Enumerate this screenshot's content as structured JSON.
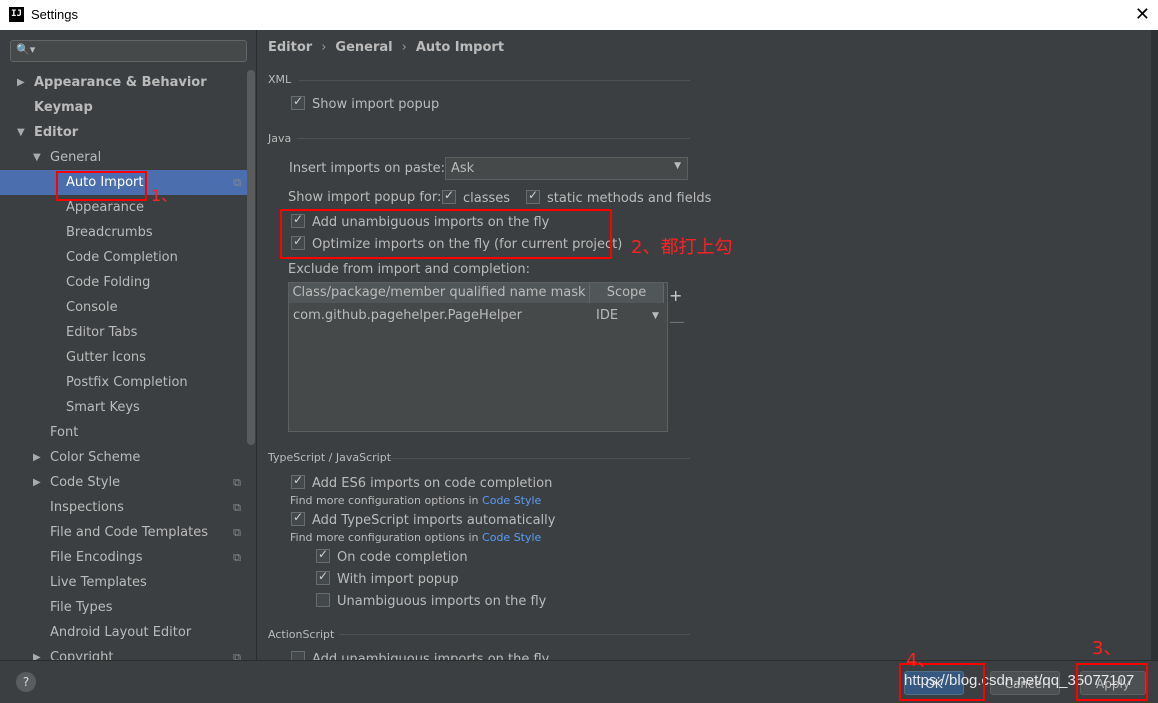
{
  "window": {
    "title": "Settings",
    "app_icon": "IJ",
    "close": "✕"
  },
  "sidebar": {
    "search_icon": "🔍▾",
    "items": [
      {
        "label": "Appearance & Behavior",
        "level": 0,
        "arrow": "▶",
        "bold": true
      },
      {
        "label": "Keymap",
        "level": 0,
        "arrow": "",
        "bold": true
      },
      {
        "label": "Editor",
        "level": 0,
        "arrow": "▼",
        "bold": true
      },
      {
        "label": "General",
        "level": 1,
        "arrow": "▼"
      },
      {
        "label": "Auto Import",
        "level": 2,
        "selected": true,
        "copy": true
      },
      {
        "label": "Appearance",
        "level": 2
      },
      {
        "label": "Breadcrumbs",
        "level": 2
      },
      {
        "label": "Code Completion",
        "level": 2
      },
      {
        "label": "Code Folding",
        "level": 2
      },
      {
        "label": "Console",
        "level": 2
      },
      {
        "label": "Editor Tabs",
        "level": 2
      },
      {
        "label": "Gutter Icons",
        "level": 2
      },
      {
        "label": "Postfix Completion",
        "level": 2
      },
      {
        "label": "Smart Keys",
        "level": 2
      },
      {
        "label": "Font",
        "level": 1
      },
      {
        "label": "Color Scheme",
        "level": 1,
        "arrow": "▶"
      },
      {
        "label": "Code Style",
        "level": 1,
        "arrow": "▶",
        "copy": true
      },
      {
        "label": "Inspections",
        "level": 1,
        "copy": true
      },
      {
        "label": "File and Code Templates",
        "level": 1,
        "copy": true
      },
      {
        "label": "File Encodings",
        "level": 1,
        "copy": true
      },
      {
        "label": "Live Templates",
        "level": 1
      },
      {
        "label": "File Types",
        "level": 1
      },
      {
        "label": "Android Layout Editor",
        "level": 1
      },
      {
        "label": "Copyright",
        "level": 1,
        "arrow": "▶",
        "copy": true
      }
    ]
  },
  "breadcrumb": {
    "a": "Editor",
    "b": "General",
    "c": "Auto Import",
    "sep": "›"
  },
  "xml": {
    "title": "XML",
    "show_import_popup": "Show import popup"
  },
  "java": {
    "title": "Java",
    "insert_label": "Insert imports on paste:",
    "insert_value": "Ask",
    "show_popup_label": "Show import popup for:",
    "classes": "classes",
    "static_methods": "static methods and fields",
    "add_unambiguous": "Add unambiguous imports on the fly",
    "optimize": "Optimize imports on the fly (for current project)",
    "exclude_label": "Exclude from import and completion:",
    "table": {
      "col1": "Class/package/member qualified name mask",
      "col2": "Scope",
      "row_name": "com.github.pagehelper.PageHelper",
      "row_scope": "IDE"
    }
  },
  "ts": {
    "title": "TypeScript / JavaScript",
    "add_es6": "Add ES6 imports on code completion",
    "find_more": "Find more configuration options in ",
    "code_style": "Code Style",
    "add_ts": "Add TypeScript imports automatically",
    "on_completion": "On code completion",
    "with_popup": "With import popup",
    "unambiguous": "Unambiguous imports on the fly"
  },
  "actionscript": {
    "title": "ActionScript",
    "partial": "Add unambiguous imports on the fly"
  },
  "footer": {
    "help": "?",
    "ok": "OK",
    "cancel": "Cancel",
    "apply": "Apply",
    "watermark": "https://blog.csdn.net/qq_35077107"
  },
  "annotations": {
    "a1": "1、",
    "a2": "2、都打上勾",
    "a3": "3、",
    "a4": "4、"
  },
  "colors": {
    "selection": "#4b6eaf",
    "link": "#589df6",
    "annotation": "#ff0000",
    "background": "#3c3f41"
  }
}
